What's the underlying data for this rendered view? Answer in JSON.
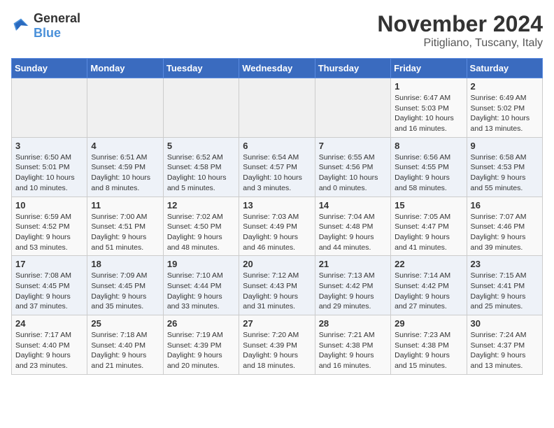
{
  "logo": {
    "general": "General",
    "blue": "Blue"
  },
  "title": "November 2024",
  "location": "Pitigliano, Tuscany, Italy",
  "days_of_week": [
    "Sunday",
    "Monday",
    "Tuesday",
    "Wednesday",
    "Thursday",
    "Friday",
    "Saturday"
  ],
  "weeks": [
    [
      {
        "day": "",
        "detail": ""
      },
      {
        "day": "",
        "detail": ""
      },
      {
        "day": "",
        "detail": ""
      },
      {
        "day": "",
        "detail": ""
      },
      {
        "day": "",
        "detail": ""
      },
      {
        "day": "1",
        "detail": "Sunrise: 6:47 AM\nSunset: 5:03 PM\nDaylight: 10 hours and 16 minutes."
      },
      {
        "day": "2",
        "detail": "Sunrise: 6:49 AM\nSunset: 5:02 PM\nDaylight: 10 hours and 13 minutes."
      }
    ],
    [
      {
        "day": "3",
        "detail": "Sunrise: 6:50 AM\nSunset: 5:01 PM\nDaylight: 10 hours and 10 minutes."
      },
      {
        "day": "4",
        "detail": "Sunrise: 6:51 AM\nSunset: 4:59 PM\nDaylight: 10 hours and 8 minutes."
      },
      {
        "day": "5",
        "detail": "Sunrise: 6:52 AM\nSunset: 4:58 PM\nDaylight: 10 hours and 5 minutes."
      },
      {
        "day": "6",
        "detail": "Sunrise: 6:54 AM\nSunset: 4:57 PM\nDaylight: 10 hours and 3 minutes."
      },
      {
        "day": "7",
        "detail": "Sunrise: 6:55 AM\nSunset: 4:56 PM\nDaylight: 10 hours and 0 minutes."
      },
      {
        "day": "8",
        "detail": "Sunrise: 6:56 AM\nSunset: 4:55 PM\nDaylight: 9 hours and 58 minutes."
      },
      {
        "day": "9",
        "detail": "Sunrise: 6:58 AM\nSunset: 4:53 PM\nDaylight: 9 hours and 55 minutes."
      }
    ],
    [
      {
        "day": "10",
        "detail": "Sunrise: 6:59 AM\nSunset: 4:52 PM\nDaylight: 9 hours and 53 minutes."
      },
      {
        "day": "11",
        "detail": "Sunrise: 7:00 AM\nSunset: 4:51 PM\nDaylight: 9 hours and 51 minutes."
      },
      {
        "day": "12",
        "detail": "Sunrise: 7:02 AM\nSunset: 4:50 PM\nDaylight: 9 hours and 48 minutes."
      },
      {
        "day": "13",
        "detail": "Sunrise: 7:03 AM\nSunset: 4:49 PM\nDaylight: 9 hours and 46 minutes."
      },
      {
        "day": "14",
        "detail": "Sunrise: 7:04 AM\nSunset: 4:48 PM\nDaylight: 9 hours and 44 minutes."
      },
      {
        "day": "15",
        "detail": "Sunrise: 7:05 AM\nSunset: 4:47 PM\nDaylight: 9 hours and 41 minutes."
      },
      {
        "day": "16",
        "detail": "Sunrise: 7:07 AM\nSunset: 4:46 PM\nDaylight: 9 hours and 39 minutes."
      }
    ],
    [
      {
        "day": "17",
        "detail": "Sunrise: 7:08 AM\nSunset: 4:45 PM\nDaylight: 9 hours and 37 minutes."
      },
      {
        "day": "18",
        "detail": "Sunrise: 7:09 AM\nSunset: 4:45 PM\nDaylight: 9 hours and 35 minutes."
      },
      {
        "day": "19",
        "detail": "Sunrise: 7:10 AM\nSunset: 4:44 PM\nDaylight: 9 hours and 33 minutes."
      },
      {
        "day": "20",
        "detail": "Sunrise: 7:12 AM\nSunset: 4:43 PM\nDaylight: 9 hours and 31 minutes."
      },
      {
        "day": "21",
        "detail": "Sunrise: 7:13 AM\nSunset: 4:42 PM\nDaylight: 9 hours and 29 minutes."
      },
      {
        "day": "22",
        "detail": "Sunrise: 7:14 AM\nSunset: 4:42 PM\nDaylight: 9 hours and 27 minutes."
      },
      {
        "day": "23",
        "detail": "Sunrise: 7:15 AM\nSunset: 4:41 PM\nDaylight: 9 hours and 25 minutes."
      }
    ],
    [
      {
        "day": "24",
        "detail": "Sunrise: 7:17 AM\nSunset: 4:40 PM\nDaylight: 9 hours and 23 minutes."
      },
      {
        "day": "25",
        "detail": "Sunrise: 7:18 AM\nSunset: 4:40 PM\nDaylight: 9 hours and 21 minutes."
      },
      {
        "day": "26",
        "detail": "Sunrise: 7:19 AM\nSunset: 4:39 PM\nDaylight: 9 hours and 20 minutes."
      },
      {
        "day": "27",
        "detail": "Sunrise: 7:20 AM\nSunset: 4:39 PM\nDaylight: 9 hours and 18 minutes."
      },
      {
        "day": "28",
        "detail": "Sunrise: 7:21 AM\nSunset: 4:38 PM\nDaylight: 9 hours and 16 minutes."
      },
      {
        "day": "29",
        "detail": "Sunrise: 7:23 AM\nSunset: 4:38 PM\nDaylight: 9 hours and 15 minutes."
      },
      {
        "day": "30",
        "detail": "Sunrise: 7:24 AM\nSunset: 4:37 PM\nDaylight: 9 hours and 13 minutes."
      }
    ]
  ]
}
